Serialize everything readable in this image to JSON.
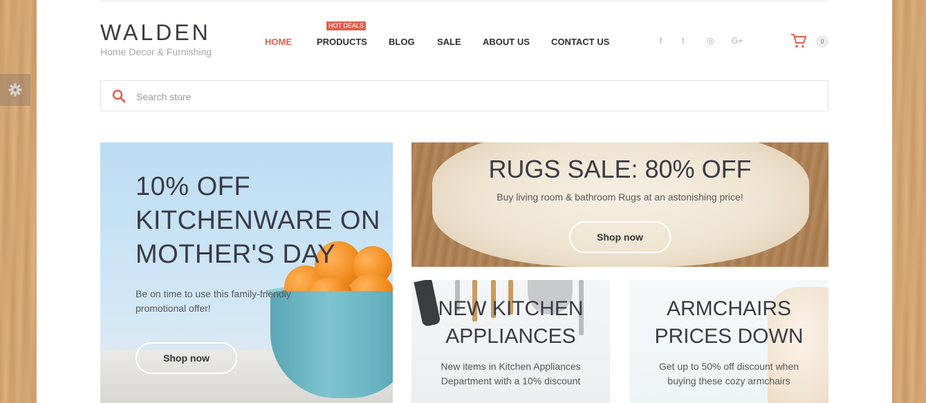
{
  "brand": {
    "name": "WALDEN",
    "tagline": "Home Decor & Furnishing"
  },
  "nav": {
    "items": [
      {
        "label": "HOME",
        "active": true
      },
      {
        "label": "PRODUCTS"
      },
      {
        "label": "BLOG"
      },
      {
        "label": "SALE"
      },
      {
        "label": "ABOUT US"
      },
      {
        "label": "CONTACT US"
      }
    ],
    "badge": "HOT DEALS"
  },
  "social": [
    "facebook-icon",
    "twitter-icon",
    "instagram-icon",
    "google-plus-icon"
  ],
  "social_glyphs": [
    "f",
    "t",
    "◎",
    "G+"
  ],
  "cart": {
    "count": "0"
  },
  "search": {
    "placeholder": "Search store"
  },
  "banners": {
    "kitchenware": {
      "title_lines": [
        "10% OFF",
        "KITCHENWARE ON",
        "MOTHER'S DAY"
      ],
      "desc": "Be on time to use this family-friendly promotional offer!",
      "button": "Shop now"
    },
    "rugs": {
      "title": "RUGS SALE: 80% OFF",
      "desc": "Buy living room & bathroom Rugs at an astonishing price!",
      "button": "Shop now"
    },
    "appliances": {
      "title_lines": [
        "NEW KITCHEN",
        "APPLIANCES"
      ],
      "desc_lines": [
        "New items in Kitchen Appliances",
        "Department with a 10% discount"
      ]
    },
    "armchairs": {
      "title_lines": [
        "ARMCHAIRS",
        "PRICES DOWN"
      ],
      "desc_lines": [
        "Get up to 50% off discount when",
        "buying these cozy armchairs"
      ]
    }
  },
  "colors": {
    "accent": "#e0604e",
    "text": "#3a3a45",
    "wood": "#d6a874"
  }
}
